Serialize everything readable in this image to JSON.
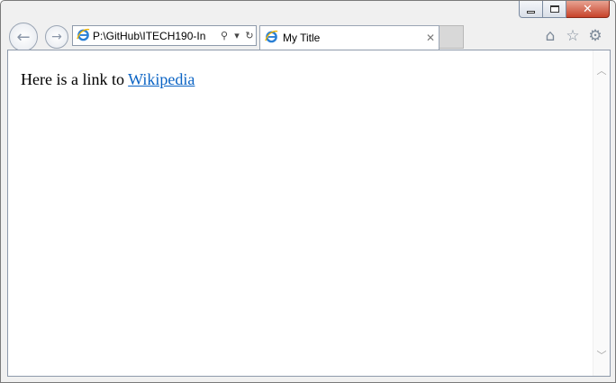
{
  "window": {
    "caption_buttons": {
      "minimize_icon": "minimize-icon",
      "maximize_icon": "maximize-icon",
      "close_glyph": "✕"
    }
  },
  "toolbar": {
    "back_glyph": "←",
    "forward_glyph": "→",
    "address": "P:\\GitHub\\ITECH190-In",
    "search_glyph": "⚲",
    "dropdown_glyph": "▾",
    "refresh_glyph": "↻",
    "home_glyph": "⌂",
    "favorites_glyph": "☆",
    "tools_glyph": "⚙"
  },
  "tab": {
    "title": "My Title",
    "close_glyph": "✕"
  },
  "page": {
    "text": "Here is a link to ",
    "link_text": "Wikipedia"
  },
  "scrollbar": {
    "up_glyph": "︿",
    "down_glyph": "﹀"
  },
  "colors": {
    "link": "#0a63c4",
    "close_button": "#c7432a"
  }
}
